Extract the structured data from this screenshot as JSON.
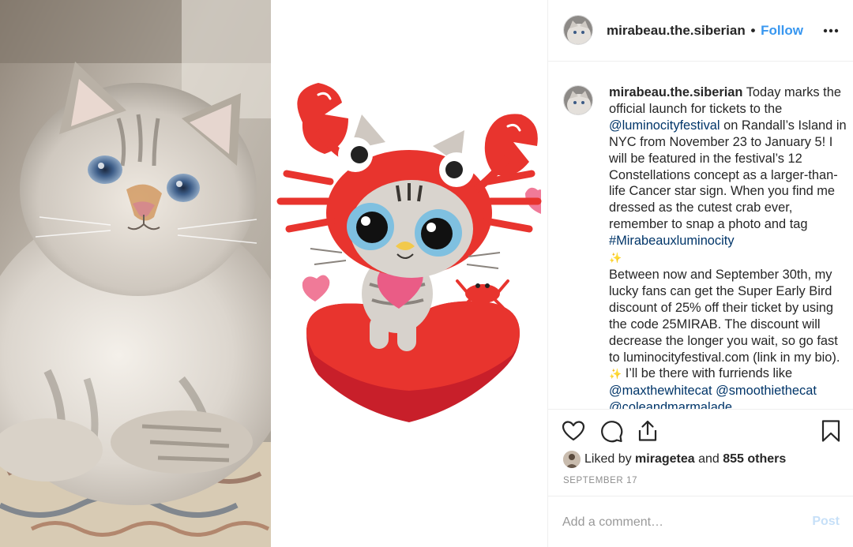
{
  "post": {
    "username": "mirabeau.the.siberian",
    "separator": "•",
    "follow_label": "Follow",
    "caption": {
      "username": "mirabeau.the.siberian",
      "t1": " Today marks the official launch for tickets to the ",
      "mention1": "@luminocityfestival",
      "t2": " on Randall’s Island in NYC from November 23 to January 5! I will be featured in the festival’s 12 Constellations concept as a larger-than-life Cancer star sign. When you find me dressed as the cutest crab ever, remember to snap a photo and tag ",
      "hashtag1": "#Mirabeauxluminocity",
      "sparkle1": "✨",
      "t3": "Between now and September 30th, my lucky fans can get the Super Early Bird discount of 25% off their ticket by using the code 25MIRAB. The discount will decrease the longer you wait, so go fast to luminocityfestival.com (link in my bio). ",
      "sparkle2": "✨",
      "t4": " I’ll be there with furriends like ",
      "mention2": "@maxthewhitecat",
      "t5": " ",
      "mention3": "@smoothiethecat",
      "t6": " ",
      "mention4": "@coleandmarmalade"
    },
    "likes": {
      "prefix": "Liked by ",
      "user": "miragetea",
      "middle": " and ",
      "count": "855 others"
    },
    "date": "SEPTEMBER 17",
    "comment": {
      "placeholder": "Add a comment…",
      "post_label": "Post"
    },
    "colors": {
      "link_blue": "#3897f0",
      "mention": "#003569",
      "crab_red": "#e8342e",
      "heart_pink": "#f07a98"
    },
    "icons": [
      "more-options-icon",
      "heart-icon",
      "comment-icon",
      "share-icon",
      "bookmark-icon"
    ]
  }
}
